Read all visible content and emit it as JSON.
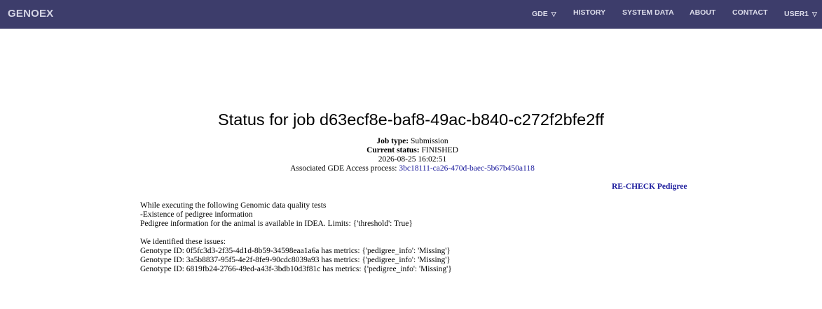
{
  "nav": {
    "brand": "GENOEX",
    "items": [
      {
        "label": "GDE",
        "has_dropdown": true
      },
      {
        "label": "HISTORY"
      },
      {
        "label": "SYSTEM DATA"
      },
      {
        "label": "ABOUT"
      },
      {
        "label": "CONTACT"
      },
      {
        "label": "USER1",
        "has_dropdown": true
      }
    ],
    "dropdown_glyph": "▽",
    "colors": {
      "background": "#3d3d6b",
      "text": "#dcdcea"
    }
  },
  "job": {
    "title": "Status for job d63ecf8e-baf8-49ac-b840-c272f2bfe2ff",
    "type_label": "Job type:",
    "type_value": "Submission",
    "status_label": "Current status:",
    "status_value": "FINISHED",
    "timestamp": "2026-08-25 16:02:51",
    "process_label": "Associated GDE Access process:",
    "process_id": "3bc18111-ca26-470d-baec-5b67b450a118"
  },
  "actions": {
    "recheck_label": "RE-CHECK Pedigree",
    "link_color": "#1a1a9c"
  },
  "report": {
    "intro": "While executing the following Genomic data quality tests",
    "test_name": "-Existence of pedigree information",
    "test_description": "Pedigree information for the animal is available in IDEA. Limits: {'threshold': True}",
    "issues_heading": "We identified these issues:",
    "issues": [
      "Genotype ID: 0f5fc3d3-2f35-4d1d-8b59-34598eaa1a6a has metrics: {'pedigree_info': 'Missing'}",
      "Genotype ID: 3a5b8837-95f5-4e2f-8fe9-90cdc8039a93 has metrics: {'pedigree_info': 'Missing'}",
      "Genotype ID: 6819fb24-2766-49ed-a43f-3bdb10d3f81c has metrics: {'pedigree_info': 'Missing'}"
    ]
  }
}
